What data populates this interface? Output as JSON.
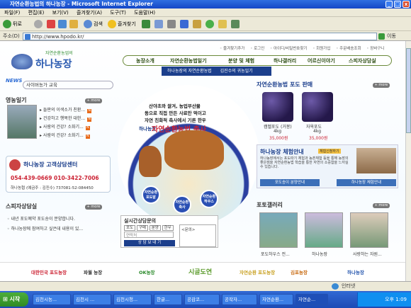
{
  "window": {
    "title": "자연순환농법의 하나농장 - Microsoft Internet Explorer",
    "controls": [
      "_",
      "□",
      "x"
    ]
  },
  "menubar": [
    "파일(F)",
    "편집(E)",
    "보기(V)",
    "즐겨찾기(A)",
    "도구(T)",
    "도움말(H)"
  ],
  "toolbar": {
    "back": "뒤로",
    "search": "검색",
    "favorites": "즐겨찾기"
  },
  "address": {
    "label": "주소(D)",
    "url": "http://www.hpodo.kr/",
    "go": "이동"
  },
  "site": {
    "top_links": [
      "◦ 즐겨찾기추가",
      "◦ 로그인",
      "◦ 아이디/비밀번호찾기",
      "◦ 회원가입",
      "◦ 주문배송조회",
      "◦ 장바구니"
    ],
    "logo_sub": "자연순환농업의",
    "logo_main": "하나농장",
    "nav": [
      "농장소개",
      "자연순환농법일기",
      "분양 및 체험",
      "하나갤러리",
      "어르신이야기",
      "스피자상담실"
    ],
    "subnav": [
      "하나농장의 자연순환농법",
      "김진수의 귀농일기"
    ],
    "news_label": "NEWS",
    "news_text": "사이버농가 교육",
    "diary_title": "영농일기",
    "more": "+ more",
    "diary_items": [
      "들판의 이색소가 친환...",
      "건강하고 행복한 대한...",
      "사람의 건강? 소화기...",
      "사람의 건강? 소화기..."
    ],
    "consult_title": "하나농장 고객상담센터",
    "consult_phone": "054-439-0669  010-3422-7006",
    "consult_bank": "하나농협 (예금주 : 김진수)  737081-52-084450",
    "qa_title": "스피자상담실",
    "qa_items": [
      "◦ 내년 포도예약 포도송이 분양합니다.",
      "◦ 하나농장에 참여하고 싶은데 내용이 있..."
    ],
    "promo_lines": [
      "산야초와 쌀겨, 농업부산물",
      "동으로 직접 만든 사료만 먹이고",
      "자연 친화적 축사에서 기른 한우"
    ],
    "promo_brand": "하나농장",
    "promo_headline": "자연순환농법 축사",
    "badges": [
      "자연순환\n포도밭",
      "자연순환\n축사",
      "자연순환\n하우스"
    ],
    "form_title": "실시간상담문의",
    "form_tabs": [
      "포도",
      "구매",
      "분양",
      "한우"
    ],
    "form_name_label": "연락처",
    "form_memo": "<문의>",
    "form_submit": "상 담 보 내 기",
    "shop_title": "자연순환농법 포도 판매",
    "products": [
      {
        "name": "캠벨포도 (거봉)",
        "weight": "4kg",
        "price": "35,000원"
      },
      {
        "name": "자옥포도",
        "weight": "4kg",
        "price": "35,000원"
      }
    ],
    "exp_title": "하나농장 체험안내",
    "exp_badge": "체험신청하기",
    "exp_text": "하나농장에서는 포도따기 체험과 농촌체험 등을 통해 농장의 좋은점을 자연순환농법 학습을 통한 자연의 소중함을 느끼실 수 있습니다.",
    "exp_buttons": [
      "포도송이 분양안내",
      "하나농장 체험안내"
    ],
    "gallery_title": "포토갤러리",
    "gallery": [
      "포도하우스 전...",
      "하나농장",
      "사랑하는 자원..."
    ],
    "partners": [
      "대한민국 포도농장",
      "파월 농장",
      "OK농장",
      "시골도연",
      "자연순환 포도농장",
      "김포농장",
      "하나농장"
    ]
  },
  "status": {
    "text": "",
    "zone": "인터넷"
  },
  "taskbar": {
    "start": "시작",
    "tasks": [
      "김천시농...",
      "김천시 ...",
      "김천시청...",
      "한글...",
      "공감코...",
      "공작자...",
      "자연순환...",
      "자연순..."
    ],
    "clock": "오후 1:09"
  }
}
